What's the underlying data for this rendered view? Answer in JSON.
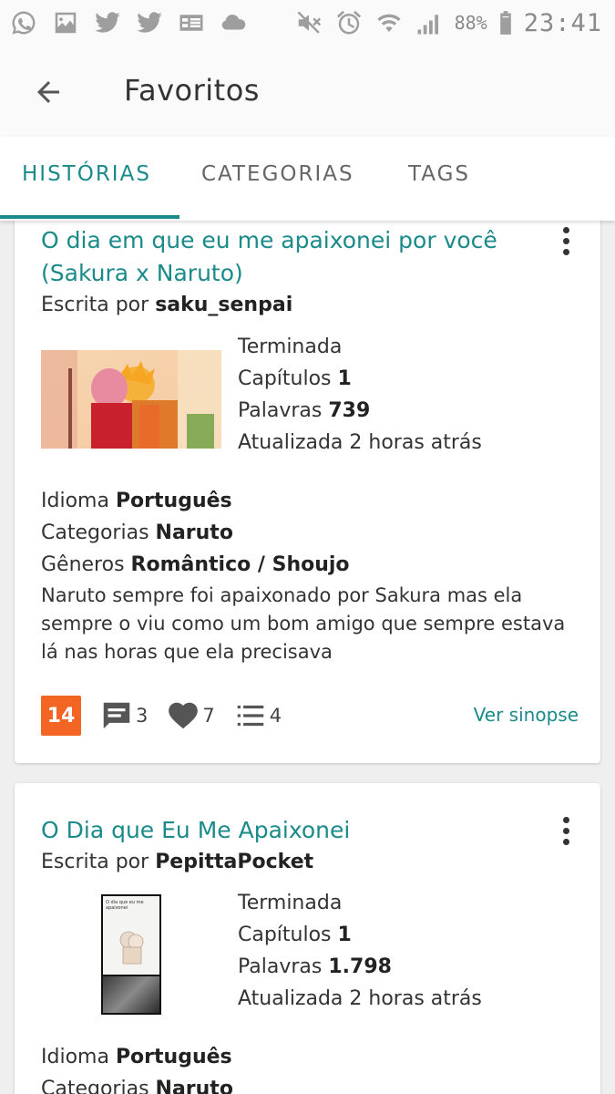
{
  "status_bar": {
    "left_icons": [
      "whatsapp-icon",
      "gallery-icon",
      "twitter-icon",
      "twitter-icon",
      "news-icon",
      "cloud-icon"
    ],
    "right_icons": [
      "mute-icon",
      "alarm-icon",
      "wifi-icon",
      "signal-icon"
    ],
    "battery": "88%",
    "time": "23:41"
  },
  "app_bar": {
    "title": "Favoritos"
  },
  "tabs": [
    {
      "label": "HISTÓRIAS",
      "active": true
    },
    {
      "label": "CATEGORIAS",
      "active": false
    },
    {
      "label": "TAGS",
      "active": false
    }
  ],
  "colors": {
    "accent": "#1b8a8a",
    "rating": "#f26522"
  },
  "stories": [
    {
      "title": "O dia em que eu me apaixonei por você (Sakura x Naruto)",
      "author_prefix": "Escrita por",
      "author": "saku_senpai",
      "status": "Terminada",
      "chapters_label": "Capítulos",
      "chapters": "1",
      "words_label": "Palavras",
      "words": "739",
      "updated": "Atualizada 2 horas atrás",
      "language_label": "Idioma",
      "language": "Português",
      "categories_label": "Categorias",
      "categories": "Naruto",
      "genres_label": "Gêneros",
      "genres": "Romântico / Shoujo",
      "synopsis": "Naruto sempre foi apaixonado por Sakura mas ela sempre o viu como um bom amigo que sempre estava lá nas horas que ela precisava",
      "rating": "14",
      "comments": "3",
      "likes": "7",
      "lists": "4",
      "see_synopsis": "Ver sinopse"
    },
    {
      "title": "O Dia que Eu Me Apaixonei",
      "author_prefix": "Escrita por",
      "author": "PepittaPocket",
      "status": "Terminada",
      "chapters_label": "Capítulos",
      "chapters": "1",
      "words_label": "Palavras",
      "words": "1.798",
      "updated": "Atualizada 2 horas atrás",
      "language_label": "Idioma",
      "language": "Português",
      "categories_label": "Categorias",
      "categories": "Naruto",
      "cover_text": "O dia que eu me apaixonei"
    }
  ]
}
